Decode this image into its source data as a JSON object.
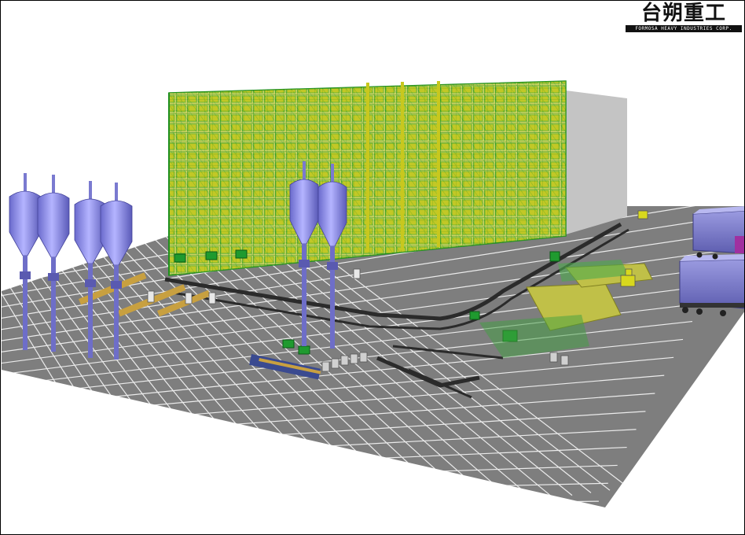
{
  "logo": {
    "chinese": "台朔重工",
    "english": "FORMOSA HEAVY INDUSTRIES CORP."
  },
  "colors": {
    "floor": "#7e7e7e",
    "floor_grid": "#ffffff",
    "rack_green": "#2fa52f",
    "rack_yellow": "#c8c81e",
    "silo": "#8a8ae6",
    "conveyor": "#2b2b2b",
    "wall": "#c4c4c4"
  },
  "scene": {
    "description_icons": [
      "silo-icon",
      "storage-rack-icon",
      "conveyor-icon",
      "forklift-icon",
      "truck-icon",
      "robot-arm-icon"
    ]
  }
}
